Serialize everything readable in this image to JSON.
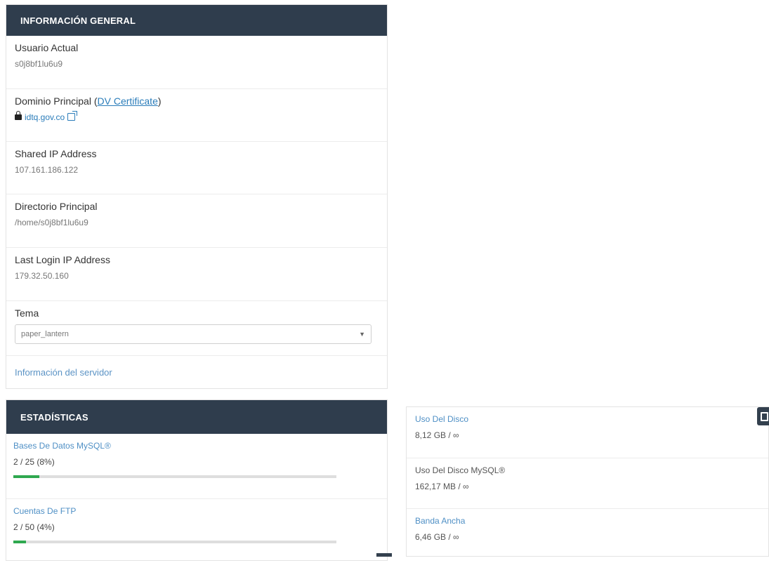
{
  "general": {
    "header": "INFORMACIÓN GENERAL",
    "current_user_label": "Usuario Actual",
    "current_user_value": "s0j8bf1lu6u9",
    "main_domain_label": "Dominio Principal",
    "dv_certificate_link": "DV Certificate",
    "main_domain_open_paren": " (",
    "main_domain_close_paren": ")",
    "main_domain_value": "idtq.gov.co",
    "shared_ip_label": "Shared IP Address",
    "shared_ip_value": "107.161.186.122",
    "home_dir_label": "Directorio Principal",
    "home_dir_value": "/home/s0j8bf1lu6u9",
    "last_login_label": "Last Login IP Address",
    "last_login_value": "179.32.50.160",
    "theme_label": "Tema",
    "theme_selected": "paper_lantern",
    "server_info_link": "Información del servidor"
  },
  "stats": {
    "header": "ESTADÍSTICAS",
    "items": [
      {
        "label": "Bases De Datos MySQL®",
        "value": "2 / 25  (8%)",
        "percent": 8
      },
      {
        "label": "Cuentas De FTP",
        "value": "2 / 50  (4%)",
        "percent": 4
      }
    ]
  },
  "usage": {
    "items": [
      {
        "label": "Uso Del Disco",
        "value": "8,12 GB / ∞",
        "link": true
      },
      {
        "label": "Uso Del Disco MySQL®",
        "value": "162,17 MB / ∞",
        "link": false
      },
      {
        "label": "Banda Ancha",
        "value": "6,46 GB / ∞",
        "link": true
      }
    ]
  },
  "colors": {
    "header_bg": "#2f3d4d",
    "link": "#2b7dba",
    "progress": "#2fa84f"
  },
  "icons": [
    "lock-icon",
    "external-link-icon",
    "dropdown-caret-icon",
    "panel-toggle-icon"
  ]
}
